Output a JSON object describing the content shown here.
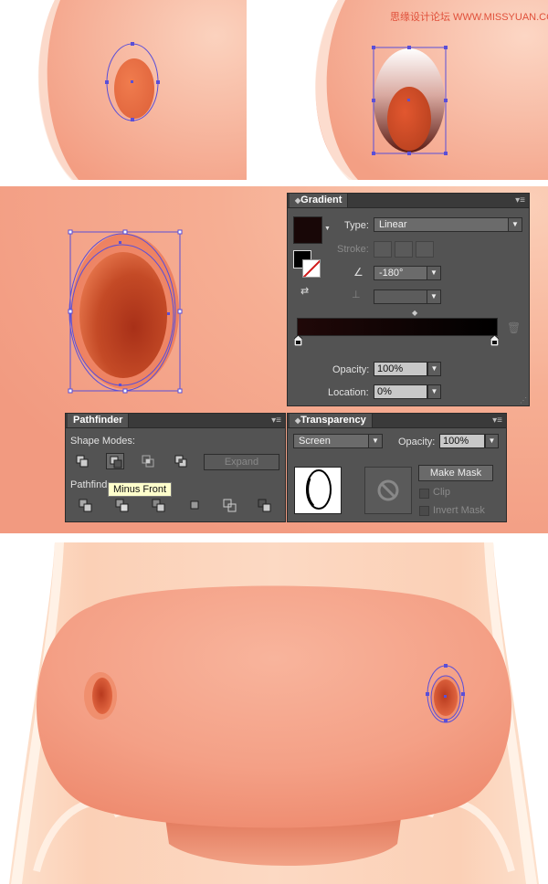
{
  "watermark": "思缘设计论坛 WWW.MISSYUAN.COM",
  "colors": {
    "skin": "#f4a88c",
    "nose": "#f09a7e",
    "hole_dark": "#b8462b",
    "selection": "#5a4fd8",
    "panel_bg": "#535353"
  },
  "gradient_panel": {
    "tab": "Gradient",
    "type_label": "Type:",
    "type_value": "Linear",
    "stroke_label": "Stroke:",
    "angle_value": "-180°",
    "opacity_label": "Opacity:",
    "opacity_value": "100%",
    "location_label": "Location:",
    "location_value": "0%"
  },
  "pathfinder_panel": {
    "tab": "Pathfinder",
    "shape_modes_label": "Shape Modes:",
    "expand_label": "Expand",
    "pathfinders_label": "Pathfind",
    "tooltip": "Minus Front"
  },
  "transparency_panel": {
    "tab": "Transparency",
    "blend_mode": "Screen",
    "opacity_label": "Opacity:",
    "opacity_value": "100%",
    "make_mask_label": "Make Mask",
    "clip_label": "Clip",
    "invert_mask_label": "Invert Mask"
  },
  "icons": [
    "swap-icon",
    "angle-icon",
    "aspect-ratio-icon",
    "gradient-stop-icon",
    "trash-icon",
    "no-mask-icon",
    "panel-menu-icon",
    "pathfinder-mode-icon"
  ]
}
